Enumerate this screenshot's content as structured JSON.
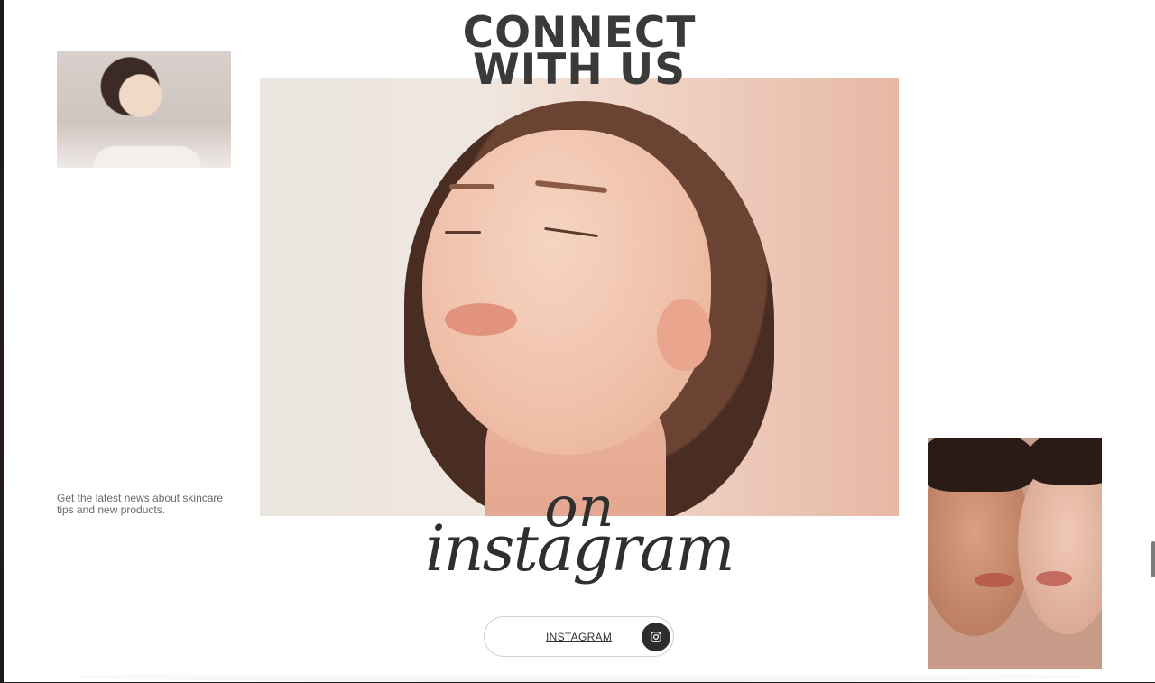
{
  "headline": {
    "line1": "CONNECT",
    "line2": "WITH US"
  },
  "script": {
    "line1": "on",
    "line2": "instagram"
  },
  "note": {
    "text": "Get the latest news about skincare tips and new products."
  },
  "instagram_button": {
    "label": "INSTAGRAM",
    "icon": "instagram-icon"
  },
  "images": {
    "top_left": "woman-applying-skincare-photo",
    "hero": "woman-eyes-closed-portrait",
    "right": "two-women-glowing-skin-photo"
  },
  "colors": {
    "text_dark": "#3a3a3a",
    "button_circle": "#2d2d2d",
    "background": "#ffffff"
  }
}
